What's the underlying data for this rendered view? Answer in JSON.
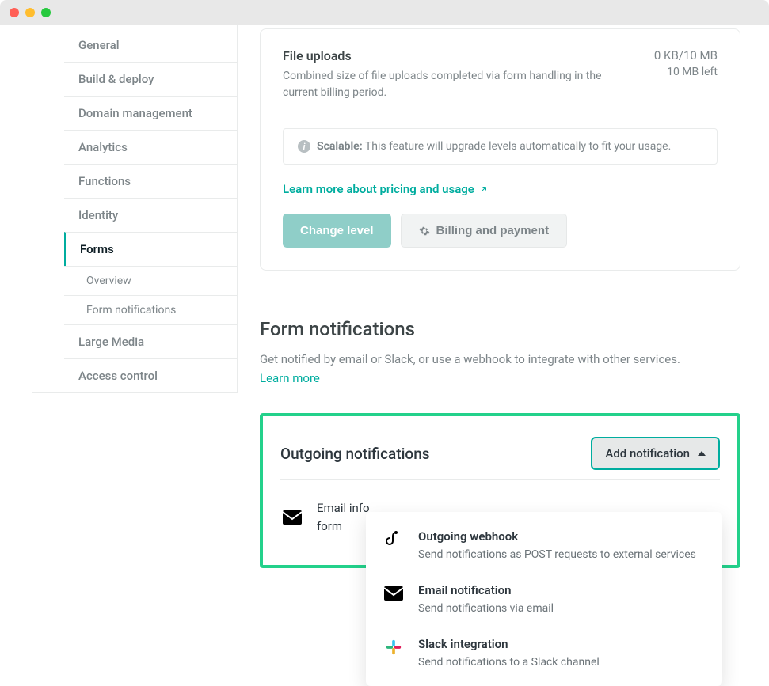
{
  "sidebar": {
    "items": [
      {
        "label": "General"
      },
      {
        "label": "Build & deploy"
      },
      {
        "label": "Domain management"
      },
      {
        "label": "Analytics"
      },
      {
        "label": "Functions"
      },
      {
        "label": "Identity"
      },
      {
        "label": "Forms",
        "active": true
      },
      {
        "label": "Large Media"
      },
      {
        "label": "Access control"
      }
    ],
    "subitems": [
      {
        "label": "Overview"
      },
      {
        "label": "Form notifications"
      }
    ]
  },
  "uploads": {
    "title": "File uploads",
    "desc": "Combined size of file uploads completed via form handling in the current billing period.",
    "stats": "0 KB/10 MB",
    "left": "10 MB left"
  },
  "banner": {
    "label": "Scalable:",
    "text": "This feature will upgrade levels automatically to fit your usage."
  },
  "links": {
    "pricing": "Learn more about pricing and usage"
  },
  "buttons": {
    "change_level": "Change level",
    "billing": "Billing and payment"
  },
  "form_notifications": {
    "title": "Form notifications",
    "desc": "Get notified by email or Slack, or use a webhook to integrate with other services.",
    "learn": "Learn more"
  },
  "outgoing": {
    "title": "Outgoing notifications",
    "add_button": "Add notification",
    "existing_line1": "Email info",
    "existing_line2": "form",
    "dropdown": [
      {
        "title": "Outgoing webhook",
        "desc": "Send notifications as POST requests to external services",
        "icon": "hook"
      },
      {
        "title": "Email notification",
        "desc": "Send notifications via email",
        "icon": "envelope"
      },
      {
        "title": "Slack integration",
        "desc": "Send notifications to a Slack channel",
        "icon": "slack"
      }
    ]
  }
}
